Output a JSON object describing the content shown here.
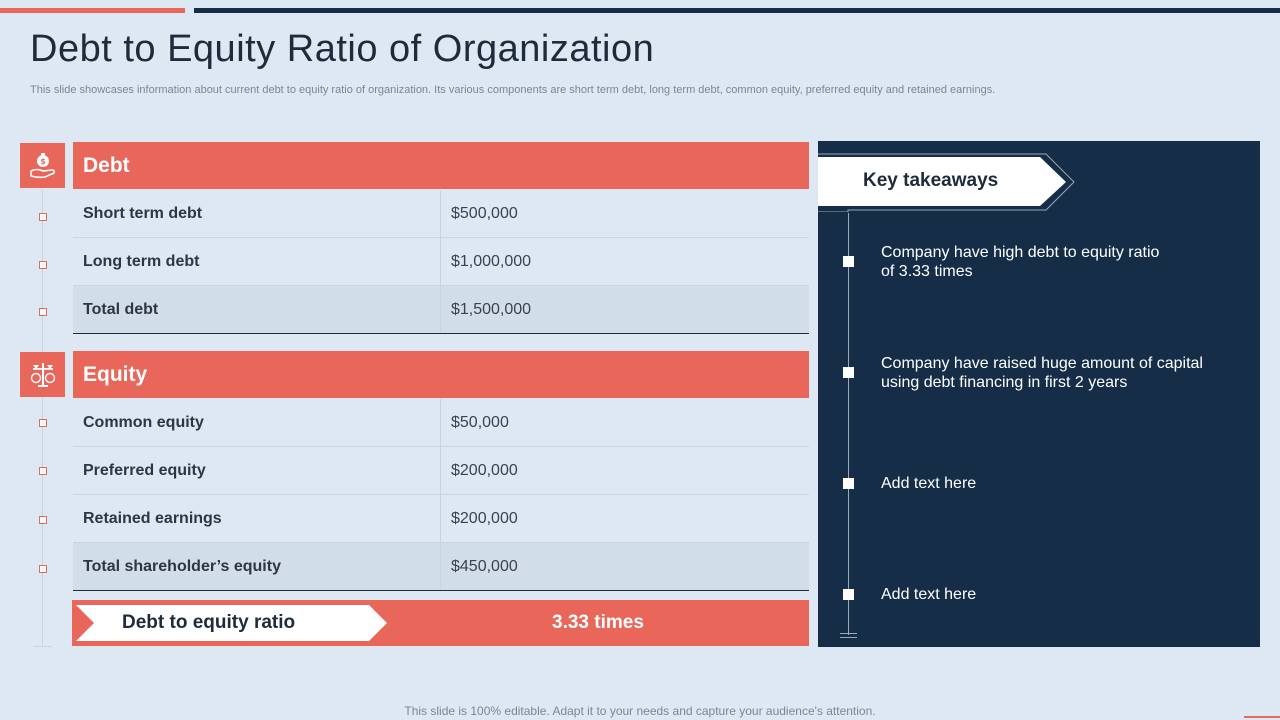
{
  "title": "Debt to Equity Ratio of Organization",
  "subtitle": "This slide showcases information about current debt to equity ratio of organization. Its various components are short term debt, long term debt, common equity, preferred equity and retained earnings.",
  "debt": {
    "header": "Debt",
    "icon": "money-bag-hand-icon",
    "rows": [
      {
        "label": "Short term debt",
        "value": "$500,000"
      },
      {
        "label": "Long term debt",
        "value": "$1,000,000"
      },
      {
        "label": "Total debt",
        "value": "$1,500,000"
      }
    ]
  },
  "equity": {
    "header": "Equity",
    "icon": "balance-scale-icon",
    "rows": [
      {
        "label": "Common equity",
        "value": "$50,000"
      },
      {
        "label": "Preferred equity",
        "value": "$200,000"
      },
      {
        "label": "Retained earnings",
        "value": "$200,000"
      },
      {
        "label": "Total shareholder’s equity",
        "value": "$450,000"
      }
    ]
  },
  "ratio": {
    "label": "Debt to equity ratio",
    "value": "3.33 times"
  },
  "takeaways": {
    "header": "Key takeaways",
    "items": [
      "Company have high debt to equity ratio of 3.33 times",
      "Company have raised huge amount of capital using debt financing in first 2 years",
      "Add text here",
      "Add text here"
    ]
  },
  "footer": "This slide is 100% editable. Adapt it to your needs and capture your audience's attention.",
  "colors": {
    "accent": "#e8665a",
    "navy": "#152d47",
    "background": "#dde8f3"
  }
}
